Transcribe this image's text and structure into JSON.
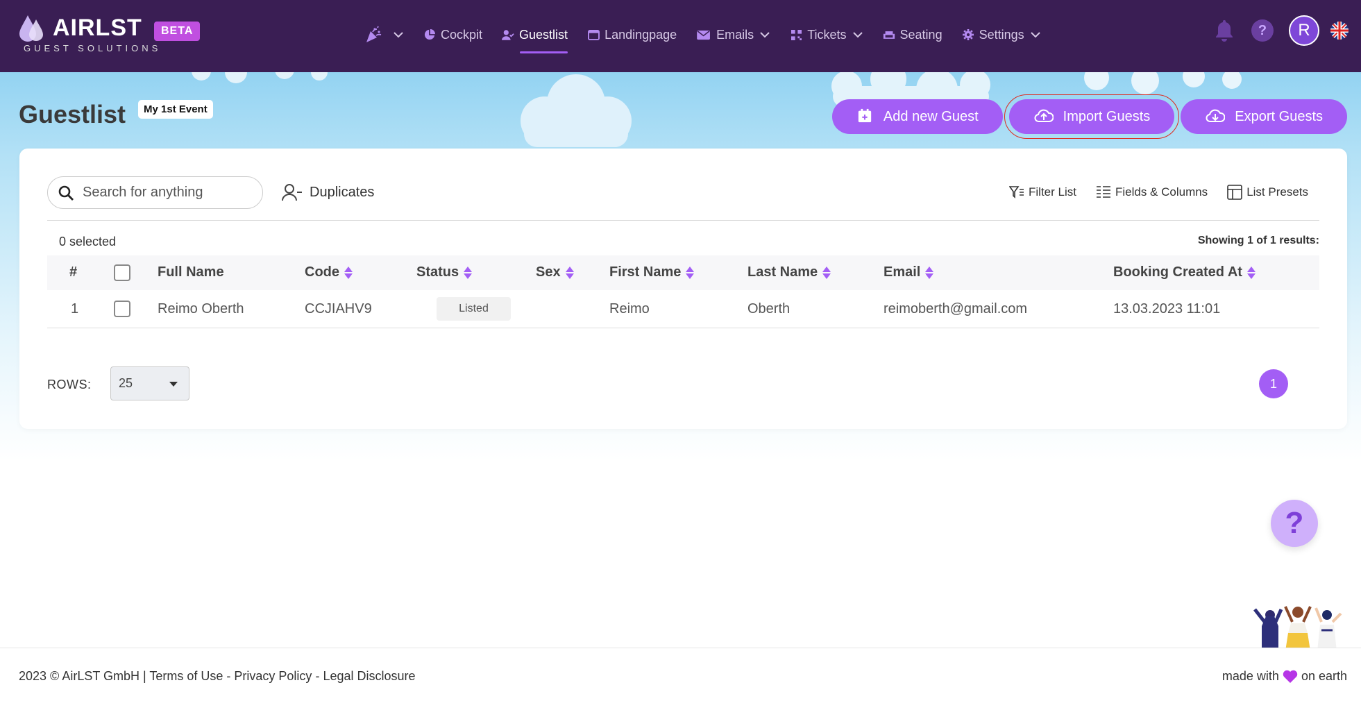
{
  "brand": {
    "name": "AIRLST",
    "tagline": "GUEST SOLUTIONS",
    "badge": "BETA"
  },
  "nav": {
    "items": [
      {
        "label": "",
        "icon": "party-popper-icon",
        "has_dropdown": true
      },
      {
        "label": "Cockpit",
        "icon": "pie-chart-icon"
      },
      {
        "label": "Guestlist",
        "icon": "user-check-icon",
        "active": true
      },
      {
        "label": "Landingpage",
        "icon": "browser-window-icon"
      },
      {
        "label": "Emails",
        "icon": "envelope-icon",
        "has_dropdown": true
      },
      {
        "label": "Tickets",
        "icon": "qr-code-icon",
        "has_dropdown": true
      },
      {
        "label": "Seating",
        "icon": "armchair-icon"
      },
      {
        "label": "Settings",
        "icon": "gear-icon",
        "has_dropdown": true
      }
    ],
    "help_label": "?",
    "avatar_initial": "R",
    "language": "en-GB"
  },
  "page": {
    "title": "Guestlist",
    "event_badge": "My 1st Event"
  },
  "actions": {
    "add": "Add new Guest",
    "import": "Import Guests",
    "export": "Export Guests"
  },
  "toolbar": {
    "search_placeholder": "Search for anything",
    "duplicates": "Duplicates",
    "filter": "Filter List",
    "fields": "Fields & Columns",
    "presets": "List Presets"
  },
  "table": {
    "selected_text": "0 selected",
    "showing_text": "Showing 1 of 1 results:",
    "columns": {
      "index": "#",
      "full_name": "Full Name",
      "code": "Code",
      "status": "Status",
      "sex": "Sex",
      "first_name": "First Name",
      "last_name": "Last Name",
      "email": "Email",
      "booking": "Booking Created At"
    },
    "rows": [
      {
        "index": "1",
        "full_name": "Reimo Oberth",
        "code": "CCJIAHV9",
        "status": "Listed",
        "sex": "",
        "first_name": "Reimo",
        "last_name": "Oberth",
        "email": "reimoberth@gmail.com",
        "booking": "13.03.2023 11:01"
      }
    ]
  },
  "pagination": {
    "rows_label": "ROWS:",
    "rows_value": "25",
    "current_page": "1"
  },
  "floating_help": "?",
  "footer": {
    "copyright": "2023 © AirLST GmbH",
    "sep1": " | ",
    "terms": "Terms of Use",
    "sep2": " - ",
    "privacy": "Privacy Policy",
    "sep3": " - ",
    "legal": "Legal Disclosure",
    "made_with": "made with",
    "on_earth": "on earth"
  },
  "colors": {
    "nav_bg": "#3a1e54",
    "accent": "#a35ef5",
    "beta": "#c04fe0",
    "sky": "#93d3f2"
  }
}
